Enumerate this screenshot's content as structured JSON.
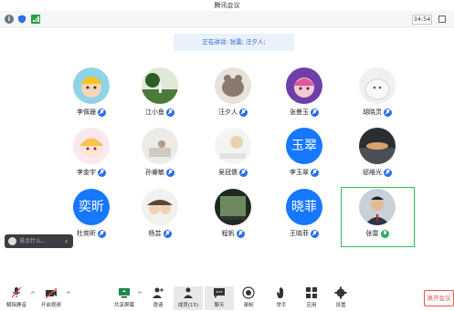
{
  "window": {
    "title": "腾讯会议"
  },
  "topbar": {
    "timer": "34:54"
  },
  "speaker": {
    "text": "正在讲话: 张雷; 汪夕人;"
  },
  "participants": [
    {
      "name": "李佩珊",
      "avatar": "cartoon-avatar",
      "mic": "blue"
    },
    {
      "name": "江小鱼",
      "avatar": "photo-avatar",
      "mic": "blue"
    },
    {
      "name": "汪夕人",
      "avatar": "photo-avatar",
      "mic": "blue"
    },
    {
      "name": "张曼玉",
      "avatar": "cartoon-avatar",
      "mic": "blue"
    },
    {
      "name": "胡晓灵",
      "avatar": "photo-avatar",
      "mic": "blue"
    },
    {
      "name": "李金宇",
      "avatar": "cartoon-avatar",
      "mic": "blue"
    },
    {
      "name": "孙睿敏",
      "avatar": "photo-avatar",
      "mic": "blue"
    },
    {
      "name": "吴冠儒",
      "avatar": "photo-avatar",
      "mic": "blue"
    },
    {
      "name": "李玉翠",
      "avatar_text": "玉翠",
      "mic": "blue"
    },
    {
      "name": "邸维光",
      "avatar": "photo-avatar",
      "mic": "blue"
    },
    {
      "name": "杜奕昕",
      "avatar_text": "奕昕",
      "mic": "blue"
    },
    {
      "name": "杨芸",
      "avatar": "photo-avatar",
      "mic": "blue"
    },
    {
      "name": "程帆",
      "avatar": "photo-avatar",
      "mic": "blue"
    },
    {
      "name": "王晓菲",
      "avatar_text": "晓菲",
      "mic": "blue"
    },
    {
      "name": "张雷",
      "avatar": "photo-avatar",
      "mic": "green"
    }
  ],
  "chat_preview": {
    "text": "说点什么..."
  },
  "toolbar": {
    "unmute": "解除静音",
    "video": "开启视频",
    "share": "共享屏幕",
    "invite": "邀请",
    "members": "成员(15)",
    "chat": "聊天",
    "record": "录制",
    "raise_hand": "举手",
    "apps": "应用",
    "settings": "设置",
    "leave": "离开会议"
  },
  "colors": {
    "accent": "#1677ff",
    "active_speaker": "#2ebf5c",
    "leave": "#e6534a"
  }
}
